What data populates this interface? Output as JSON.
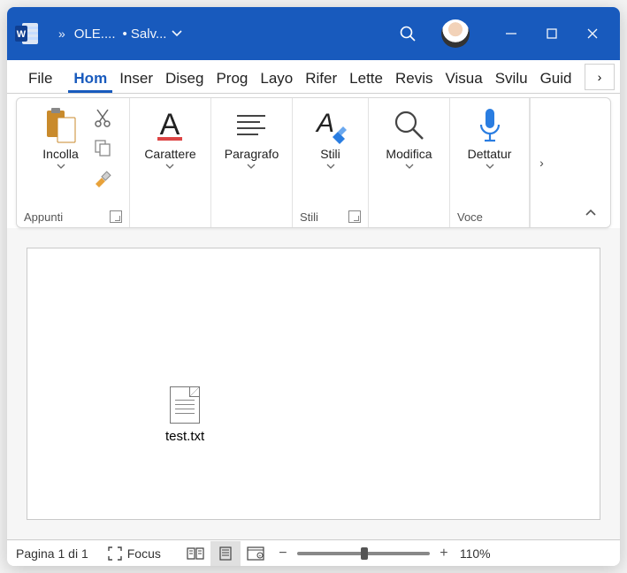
{
  "titlebar": {
    "doc_name": "OLE....",
    "save_state": "• Salv...",
    "overflow_glyph": "»"
  },
  "tabs": {
    "file": "File",
    "items": [
      "Hom",
      "Inser",
      "Diseg",
      "Prog",
      "Layo",
      "Rifer",
      "Lette",
      "Revis",
      "Visua",
      "Svilu",
      "Guid"
    ],
    "active_index": 0,
    "more_glyph": "›"
  },
  "ribbon": {
    "groups": {
      "appunti": {
        "name": "Appunti",
        "incolla": "Incolla"
      },
      "carattere": {
        "label": "Carattere"
      },
      "paragrafo": {
        "label": "Paragrafo"
      },
      "stili": {
        "name": "Stili",
        "label": "Stili"
      },
      "modifica": {
        "label": "Modifica"
      },
      "voce": {
        "name": "Voce",
        "label": "Dettatur"
      }
    },
    "more_glyph": "›",
    "collapse_glyph": "⌃"
  },
  "document": {
    "embedded_file_name": "test.txt"
  },
  "statusbar": {
    "page_info": "Pagina 1 di 1",
    "focus_label": "Focus",
    "zoom_value": "110%",
    "minus": "−",
    "plus": "+"
  }
}
